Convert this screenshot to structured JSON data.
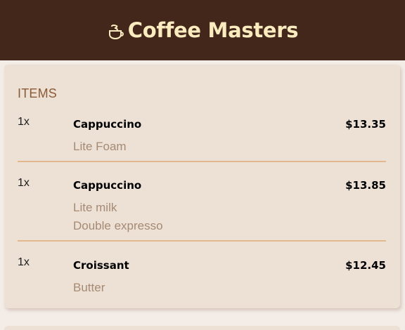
{
  "header": {
    "title": "Coffee Masters",
    "icon": "coffee-cup-icon",
    "background": "#43271a",
    "title_color": "#fbecc0"
  },
  "order": {
    "section_title": "ITEMS",
    "items": [
      {
        "qty": "1x",
        "name": "Cappuccino",
        "price": "$13.35",
        "options": [
          "Lite Foam"
        ]
      },
      {
        "qty": "1x",
        "name": "Cappuccino",
        "price": "$13.85",
        "options": [
          "Lite milk",
          "Double expresso"
        ]
      },
      {
        "qty": "1x",
        "name": "Croissant",
        "price": "$12.45",
        "options": [
          "Butter"
        ]
      }
    ]
  }
}
